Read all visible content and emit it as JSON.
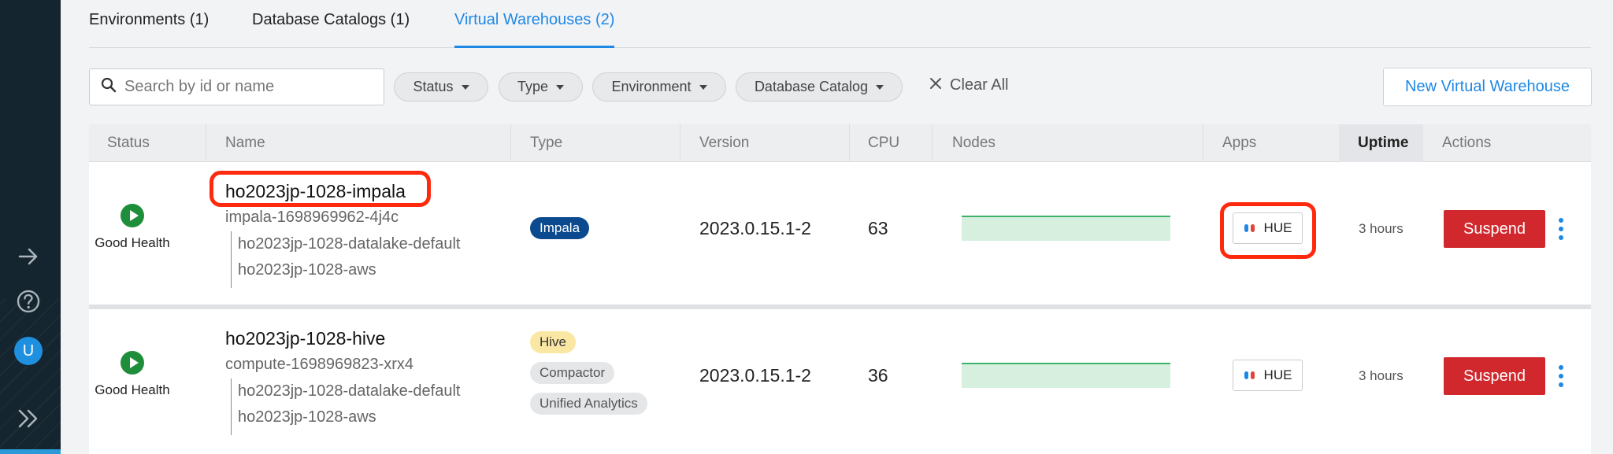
{
  "nav": {
    "icons": [
      "arrow-right-icon",
      "help-icon",
      "user-avatar",
      "expand-icon"
    ],
    "avatar_initial": "U"
  },
  "tabs": [
    {
      "label": "Environments (1)",
      "active": false
    },
    {
      "label": "Database Catalogs (1)",
      "active": false
    },
    {
      "label": "Virtual Warehouses (2)",
      "active": true
    }
  ],
  "filters": {
    "search_placeholder": "Search by id or name",
    "status": "Status",
    "type": "Type",
    "environment": "Environment",
    "database_catalog": "Database Catalog",
    "clear_all": "Clear All",
    "new_button": "New Virtual Warehouse"
  },
  "table": {
    "headers": {
      "status": "Status",
      "name": "Name",
      "type": "Type",
      "version": "Version",
      "cpu": "CPU",
      "nodes": "Nodes",
      "apps": "Apps",
      "uptime": "Uptime",
      "actions": "Actions"
    },
    "rows": [
      {
        "health": "Good Health",
        "name": "ho2023jp-1028-impala",
        "id": "impala-1698969962-4j4c",
        "catalog": "ho2023jp-1028-datalake-default",
        "environment": "ho2023jp-1028-aws",
        "types": [
          "Impala"
        ],
        "version": "2023.0.15.1-2",
        "cpu": "63",
        "app": "HUE",
        "uptime": "3 hours",
        "action": "Suspend"
      },
      {
        "health": "Good Health",
        "name": "ho2023jp-1028-hive",
        "id": "compute-1698969823-xrx4",
        "catalog": "ho2023jp-1028-datalake-default",
        "environment": "ho2023jp-1028-aws",
        "types": [
          "Hive",
          "Compactor",
          "Unified Analytics"
        ],
        "version": "2023.0.15.1-2",
        "cpu": "36",
        "app": "HUE",
        "uptime": "3 hours",
        "action": "Suspend"
      }
    ]
  },
  "colors": {
    "accent": "#1e88e5",
    "suspend": "#d0282d",
    "health": "#1f8e3a",
    "impala_badge": "#0b4a8f",
    "hive_badge": "#fbe7a4",
    "highlight": "#ff2a0e"
  }
}
